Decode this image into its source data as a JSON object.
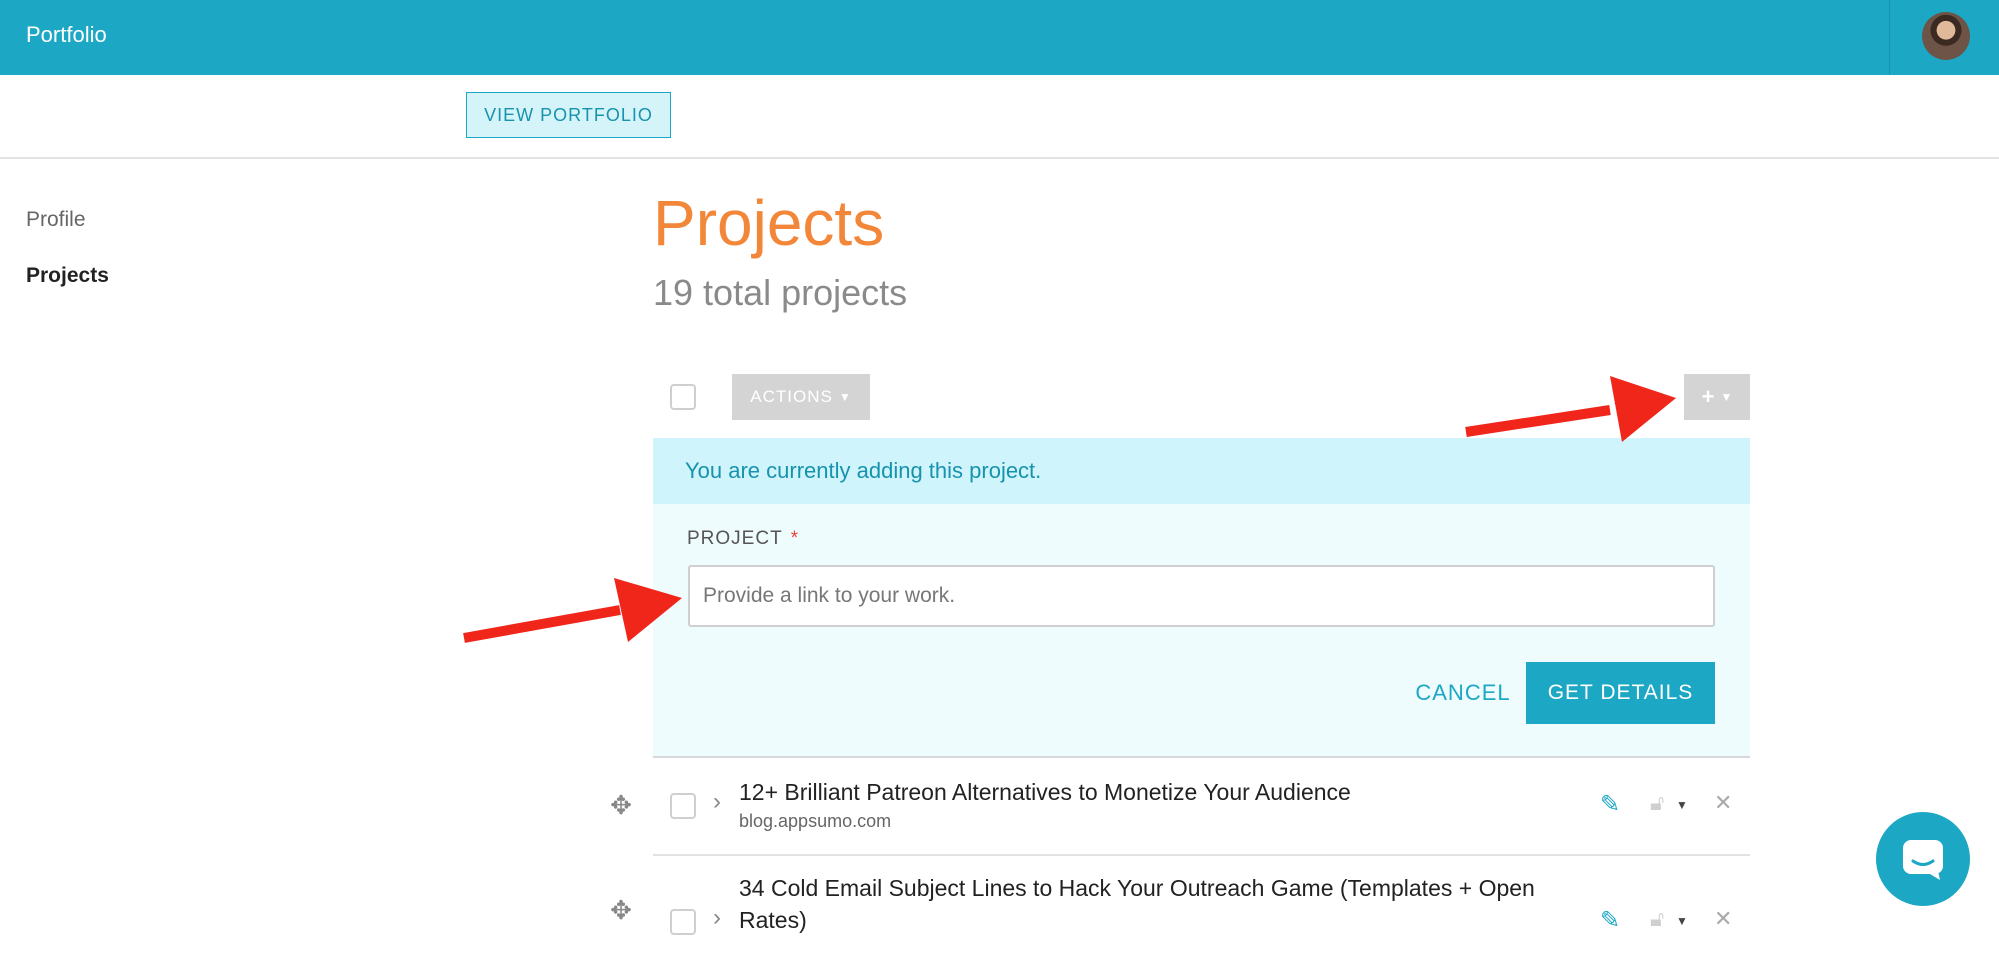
{
  "topbar": {
    "brand": "Portfolio"
  },
  "subheader": {
    "view_portfolio": "VIEW PORTFOLIO"
  },
  "sidebar": {
    "items": [
      {
        "label": "Profile"
      },
      {
        "label": "Projects"
      }
    ]
  },
  "main": {
    "title": "Projects",
    "subtitle": "19 total projects",
    "toolbar": {
      "actions_label": "ACTIONS",
      "add_symbol": "+"
    },
    "notice": "You are currently adding this project.",
    "form": {
      "field_label": "PROJECT",
      "required_mark": "*",
      "placeholder": "Provide a link to your work.",
      "cancel": "CANCEL",
      "get_details": "GET DETAILS"
    },
    "projects": [
      {
        "title": "12+ Brilliant Patreon Alternatives to Monetize Your Audience",
        "domain": "blog.appsumo.com"
      },
      {
        "title": "34 Cold Email Subject Lines to Hack Your Outreach Game (Templates + Open Rates)"
      }
    ]
  },
  "colors": {
    "accent": "#1ca7c4",
    "title_orange": "#f2873a",
    "annotation_red": "#f0261b"
  },
  "icons": [
    "move-icon",
    "chevron-right-icon",
    "pencil-icon",
    "lock-icon",
    "close-icon",
    "chat-icon"
  ]
}
